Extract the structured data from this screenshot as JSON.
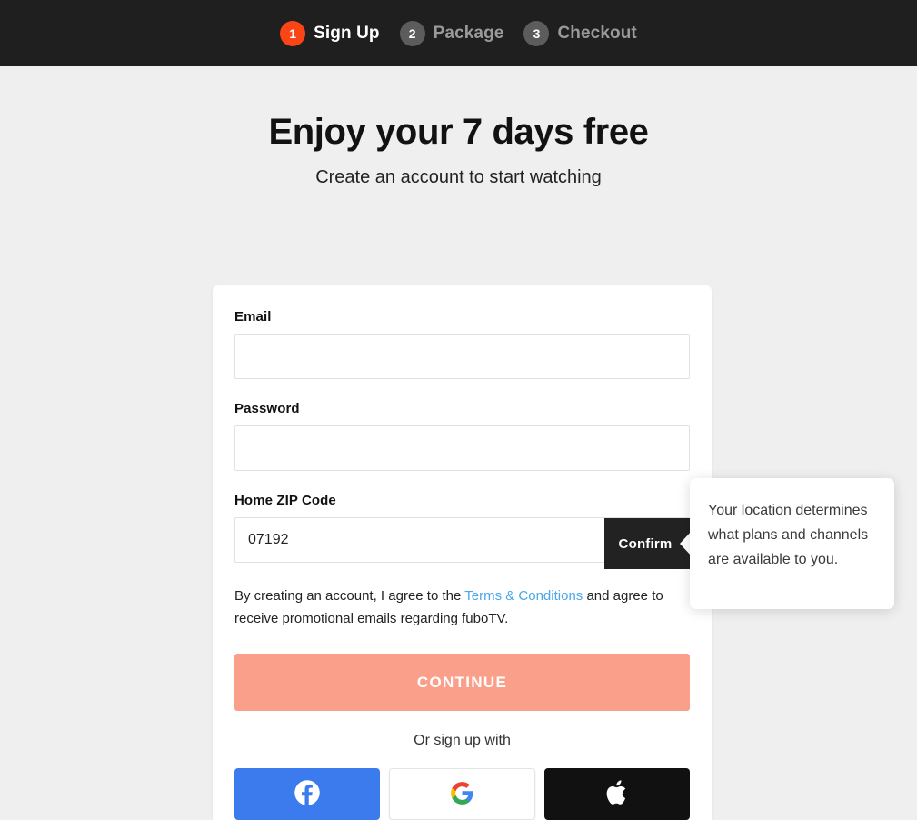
{
  "stepper": {
    "steps": [
      {
        "number": "1",
        "label": "Sign Up",
        "state": "active"
      },
      {
        "number": "2",
        "label": "Package",
        "state": "inactive"
      },
      {
        "number": "3",
        "label": "Checkout",
        "state": "inactive"
      }
    ],
    "active_color": "#fa4616",
    "inactive_color": "#5c5c5c",
    "bar_color": "#1f1f1f"
  },
  "hero": {
    "headline": "Enjoy your 7 days free",
    "subhead": "Create an account to start watching"
  },
  "form": {
    "email": {
      "label": "Email",
      "value": "",
      "placeholder": ""
    },
    "password": {
      "label": "Password",
      "value": "",
      "placeholder": ""
    },
    "zip": {
      "label": "Home ZIP Code",
      "value": "07192",
      "placeholder": ""
    },
    "confirm_button_label": "Confirm",
    "terms": {
      "before_link": "By creating an account, I agree to the ",
      "link_text": "Terms & Conditions",
      "after_link": " and agree to receive promotional emails regarding fuboTV.",
      "link_color": "#4aa7e8"
    },
    "continue_label": "CONTINUE",
    "continue_color": "#faa08a"
  },
  "social": {
    "divider_text": "Or sign up with",
    "buttons": [
      {
        "provider": "Facebook",
        "icon": "facebook-icon",
        "color": "#3b7bed"
      },
      {
        "provider": "Google",
        "icon": "google-icon",
        "color": "#ffffff"
      },
      {
        "provider": "Apple",
        "icon": "apple-icon",
        "color": "#111111"
      }
    ]
  },
  "tooltip": {
    "text": "Your location determines what plans and channels are available to you."
  }
}
